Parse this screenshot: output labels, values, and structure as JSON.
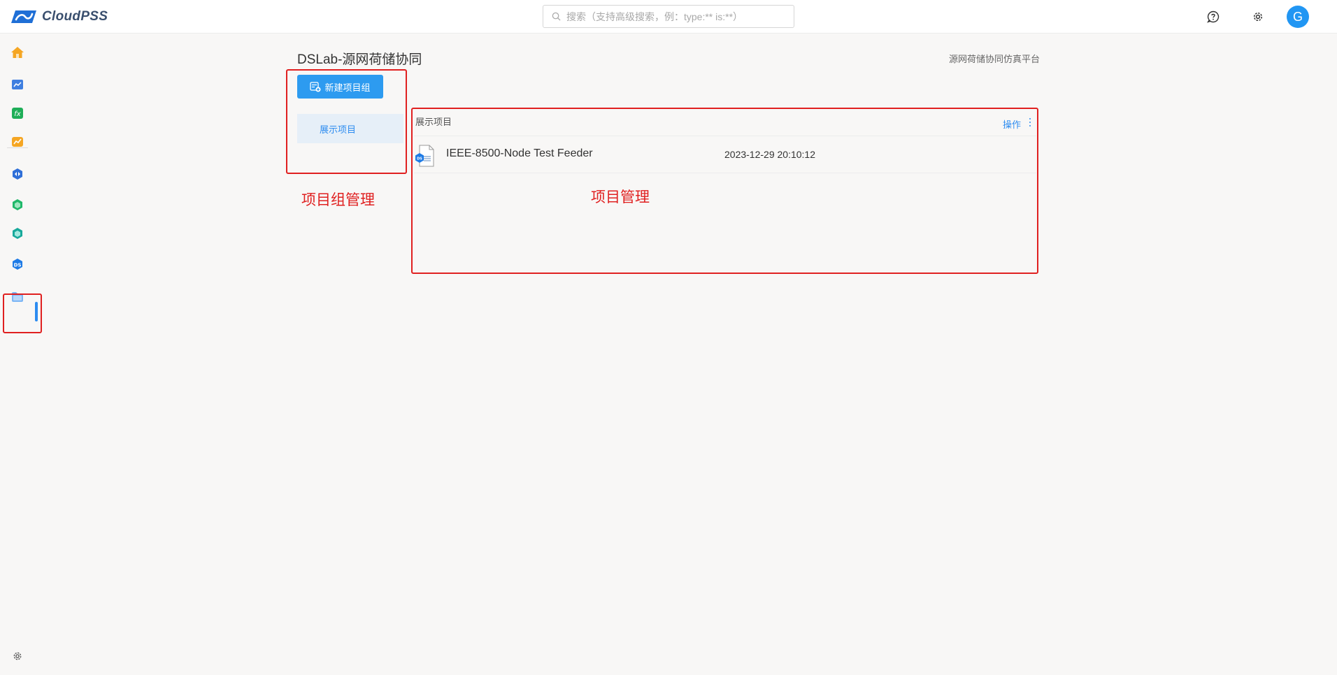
{
  "app": {
    "logo_text": "CloudPSS"
  },
  "search": {
    "placeholder": "搜索（支持高级搜索，例：type:** is:**）"
  },
  "user": {
    "avatar_initial": "G"
  },
  "page": {
    "title": "DSLab-源网荷储协同",
    "platform_label": "源网荷储协同仿真平台"
  },
  "sidebar": {
    "items": [
      {
        "icon": "home-icon"
      },
      {
        "icon": "chart-window-icon"
      },
      {
        "icon": "function-icon"
      },
      {
        "icon": "trend-icon"
      },
      {
        "icon": "simulation-icon"
      },
      {
        "icon": "hexagon-green-icon"
      },
      {
        "icon": "hexagon-teal-icon"
      },
      {
        "icon": "dslab-icon"
      },
      {
        "icon": "folder-icon"
      }
    ],
    "settings_icon": "gear-icon"
  },
  "groups": {
    "new_button_label": "新建项目组",
    "items": [
      {
        "label": "展示项目"
      }
    ]
  },
  "project_panel": {
    "title": "展示项目",
    "action_label": "操作",
    "rows": [
      {
        "name": "IEEE-8500-Node Test Feeder",
        "date": "2023-12-29 20:10:12"
      }
    ]
  },
  "annotations": {
    "group_management": "项目组管理",
    "project_management": "项目管理"
  },
  "colors": {
    "accent": "#2d9bf0",
    "annotation_red": "#e02020",
    "background": "#f8f7f6"
  }
}
